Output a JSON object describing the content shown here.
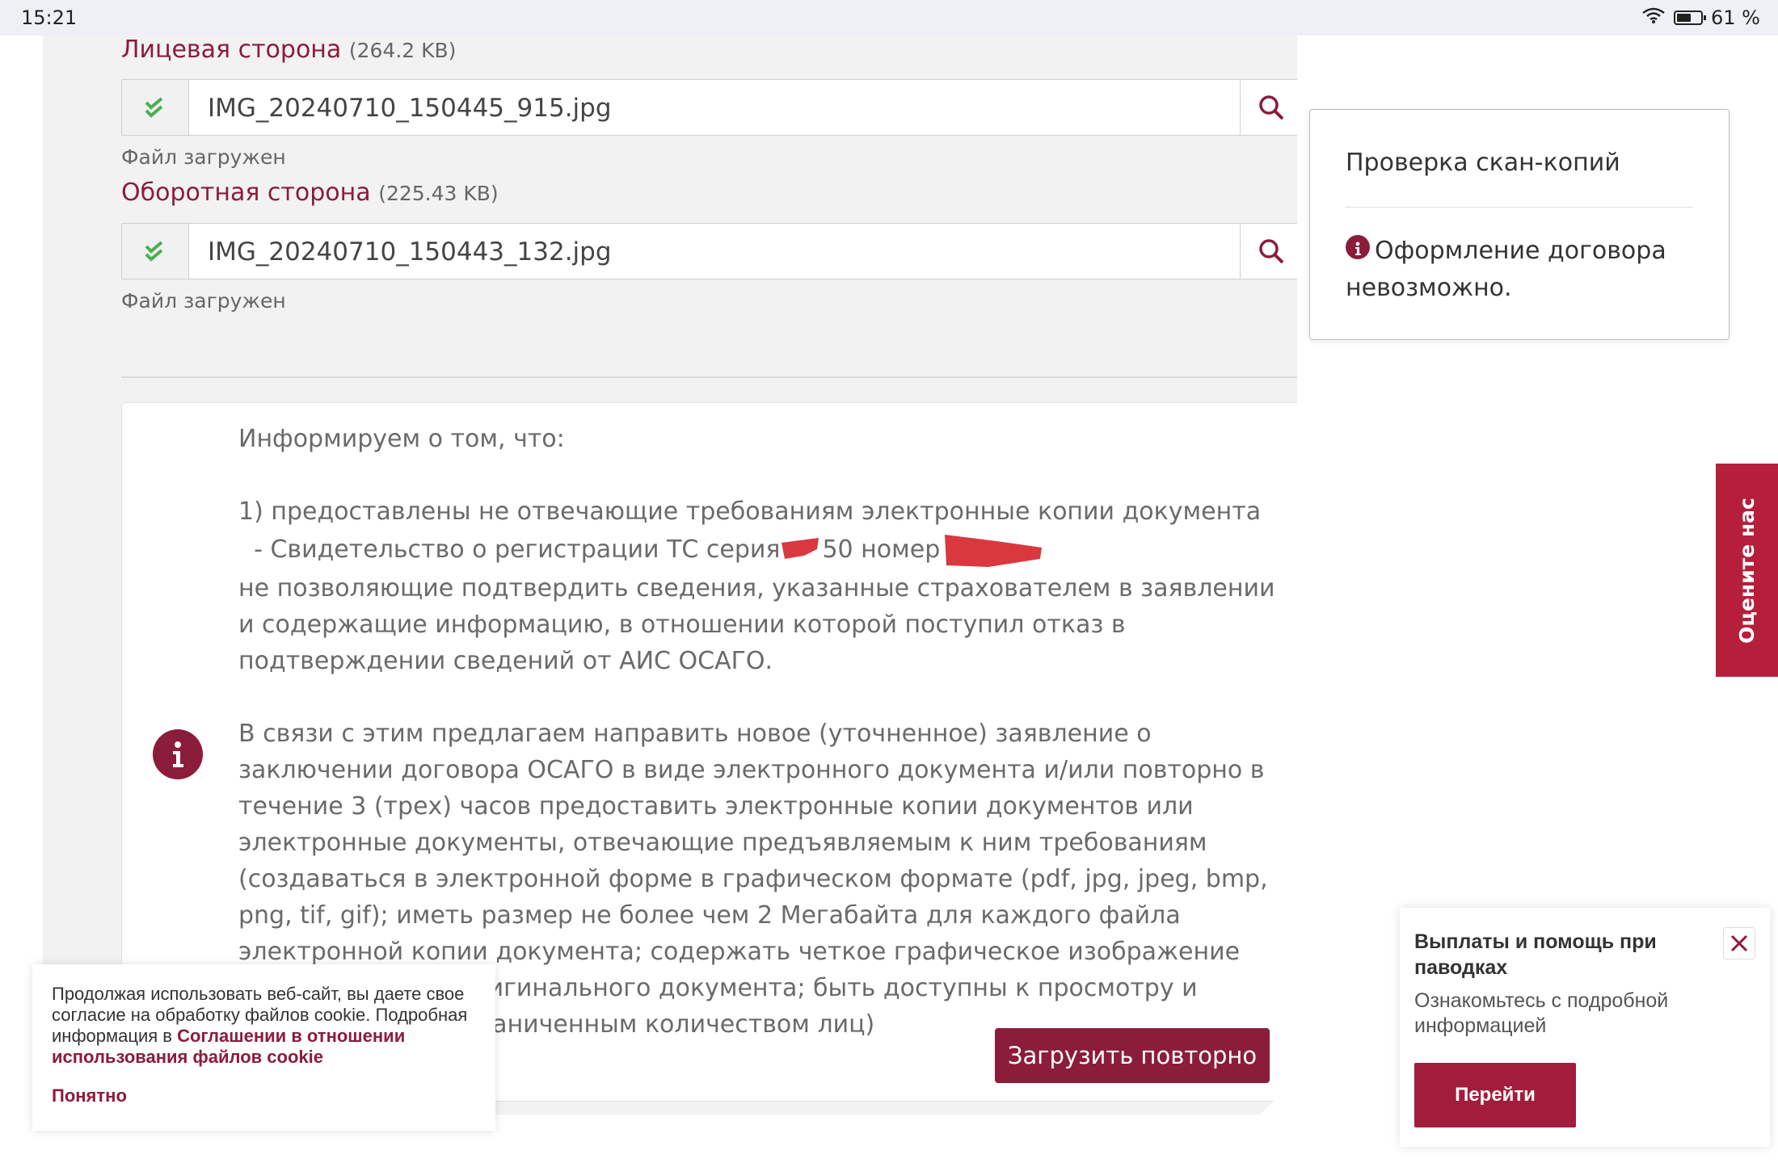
{
  "status_bar": {
    "time": "15:21",
    "battery_percent": "61 %",
    "battery_level": 0.61
  },
  "front_side": {
    "label": "Лицевая сторона",
    "size": "(264.2 KB)",
    "file_name": "IMG_20240710_150445_915.jpg",
    "status": "Файл загружен"
  },
  "back_side": {
    "label": "Оборотная сторона",
    "size": "(225.43 KB)",
    "file_name": "IMG_20240710_150443_132.jpg",
    "status": "Файл загружен"
  },
  "notice": {
    "intro": "Информируем о том, что:",
    "item1": "1) предоставлены не отвечающие требованиям электронные копии документа",
    "item1_doc_prefix": "- Свидетельство о регистрации ТС серия",
    "item1_doc_series_visible": "50",
    "item1_doc_number_label": "номер",
    "item1_rest": "не позволяющие подтвердить сведения, указанные страхователем в заявлении и содержащие информацию, в отношении которой поступил отказ в подтверждении сведений от АИС ОСАГО.",
    "proposal": "В связи с этим предлагаем направить новое (уточненное) заявление о заключении договора ОСАГО в виде электронного документа и/или повторно в течение 3 (трех) часов предоставить электронные копии документов или электронные документы, отвечающие предъявляемым к ним требованиям (создаваться в электронной форме в графическом формате (pdf, jpg, jpeg, bmp, png, tif, gif); иметь размер не более чем 2 Мегабайта для каждого файла электронной копии документа; содержать четкое графическое изображение всех реквизитов оригинального документа; быть доступны к просмотру и копированию неограниченным количеством лиц)",
    "reupload_button": "Загрузить повторно"
  },
  "check_card": {
    "title": "Проверка скан-копий",
    "message": "Оформление договора невозможно."
  },
  "feedback_tab": {
    "label": "Оцените нас"
  },
  "cookie_banner": {
    "text": "Продолжая использовать веб-сайт, вы даете свое согласие на обработку файлов cookie. Подробная информация в",
    "link": "Соглашении в отношении использования файлов cookie",
    "ok": "Понятно"
  },
  "flood_notice": {
    "title": "Выплаты и помощь при паводках",
    "text": "Ознакомьтесь с подробной информацией",
    "button": "Перейти"
  },
  "colors": {
    "brand": "#8b1c3a",
    "feedback_tab": "#b51f3c",
    "check_green": "#4caf50",
    "redaction": "#d9383f"
  }
}
